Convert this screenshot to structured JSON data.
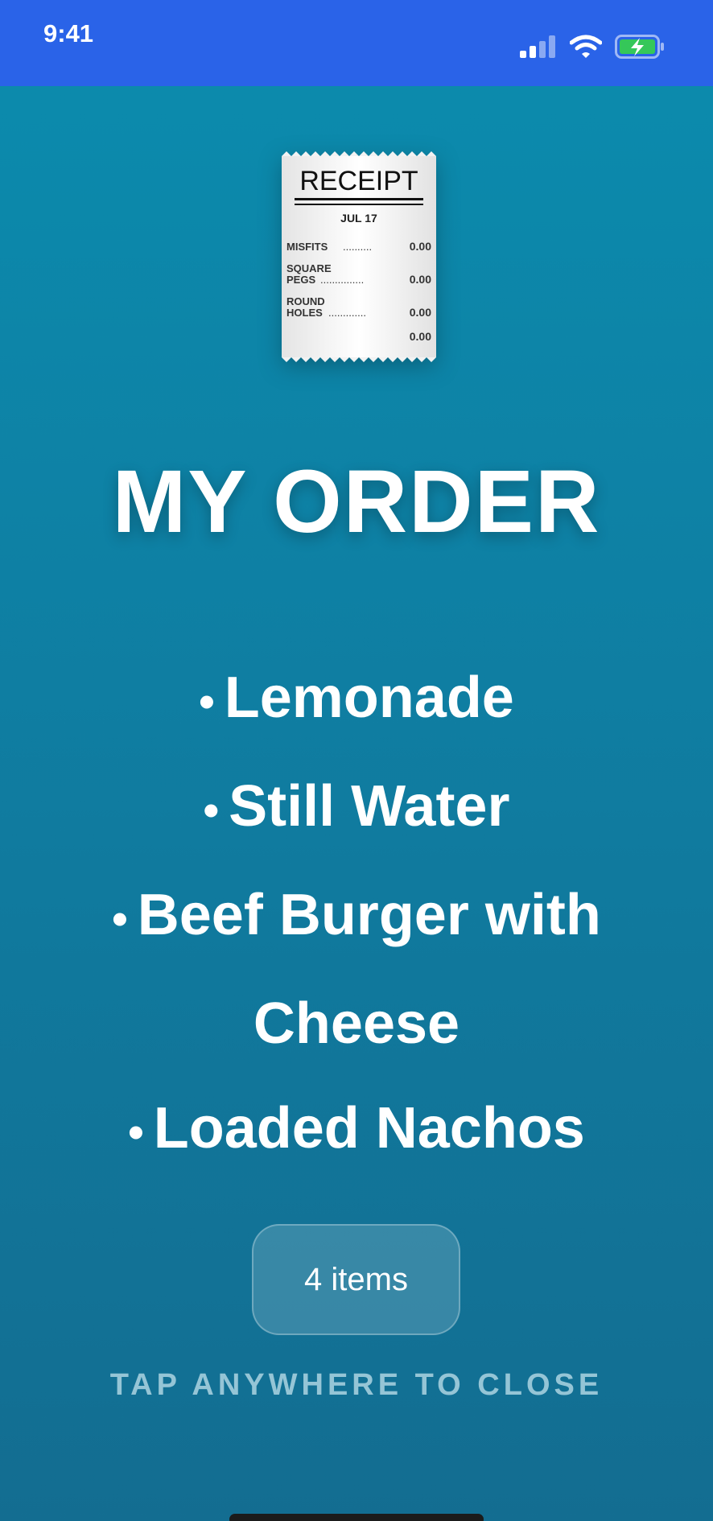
{
  "status_bar": {
    "time": "9:41",
    "signal_icon": "cellular-signal-icon",
    "wifi_icon": "wifi-icon",
    "battery_icon": "battery-charging-icon",
    "bar_color": "#2a63e8"
  },
  "receipt_icon": {
    "name": "receipt-icon",
    "heading": "RECEIPT",
    "date": "JUL 17",
    "lines": [
      {
        "label": "MISFITS",
        "amount": "0.00"
      },
      {
        "label_1": "SQUARE",
        "label_2": "PEGS",
        "amount": "0.00"
      },
      {
        "label_1": "ROUND",
        "label_2": "HOLES",
        "amount": "0.00"
      }
    ],
    "total": "0.00"
  },
  "title": "MY ORDER",
  "order": {
    "bullet": "•",
    "items": [
      "Lemonade",
      "Still Water",
      "Beef Burger with Cheese",
      "Loaded Nachos"
    ]
  },
  "count_button": {
    "label": "4 items"
  },
  "close_hint": "TAP ANYWHERE TO CLOSE",
  "colors": {
    "background_top": "#0b8cae",
    "background_bottom": "#136d91",
    "text": "#ffffff"
  }
}
